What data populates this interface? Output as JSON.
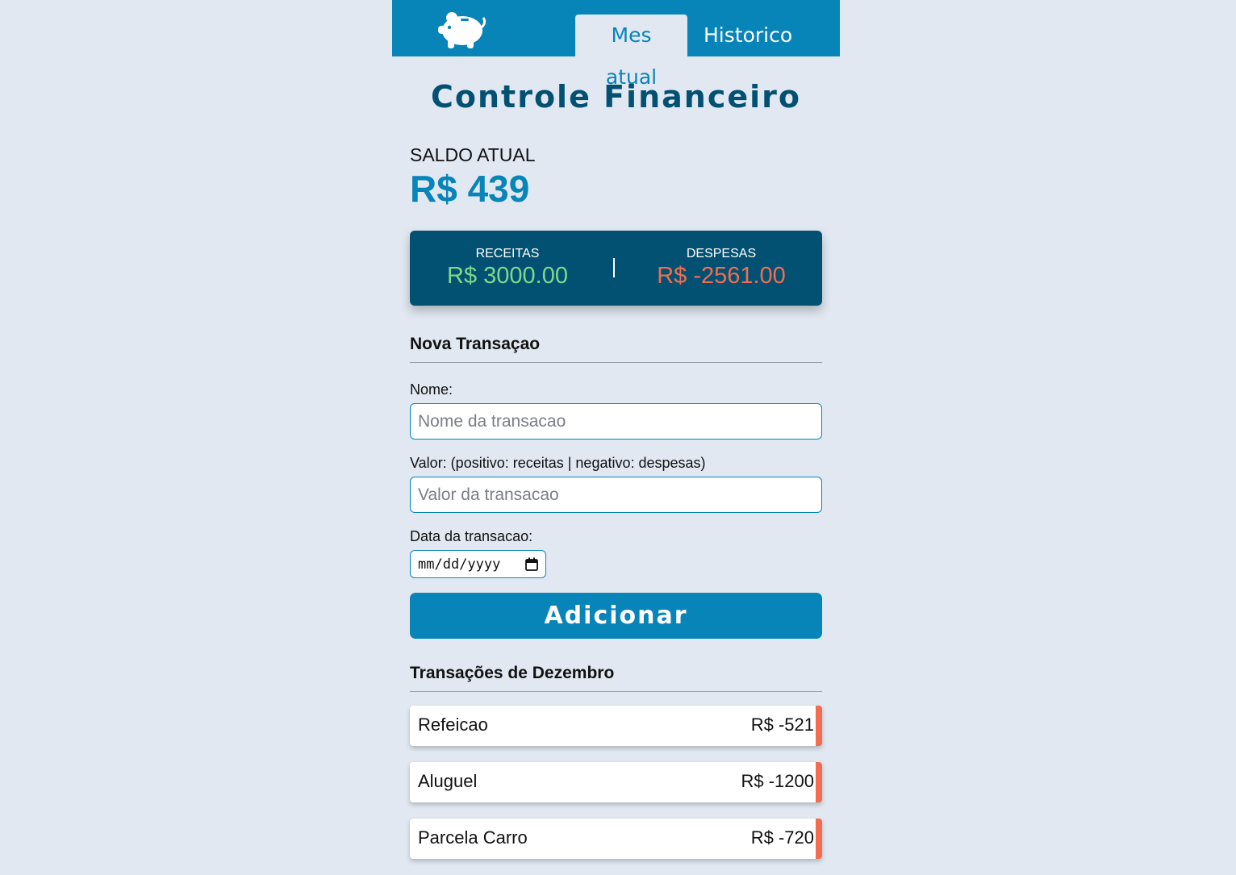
{
  "header": {
    "logo_icon": "piggy-bank-icon",
    "tabs": [
      {
        "label": "Mes atual",
        "active": true
      },
      {
        "label": "Historico",
        "active": false
      }
    ]
  },
  "page": {
    "title": "Controle Financeiro"
  },
  "balance": {
    "label": "SALDO ATUAL",
    "value": "R$ 439"
  },
  "summary": {
    "income_label": "RECEITAS",
    "income_value": "R$ 3000.00",
    "expense_label": "DESPESAS",
    "expense_value": "R$ -2561.00"
  },
  "form": {
    "title": "Nova Transaçao",
    "name_label": "Nome:",
    "name_placeholder": "Nome da transacao",
    "name_value": "",
    "value_label": "Valor: (positivo: receitas | negativo: despesas)",
    "value_placeholder": "Valor da transacao",
    "value_value": "",
    "date_label": "Data da transacao:",
    "date_placeholder": "mm/dd/yyyy",
    "submit_label": "Adicionar"
  },
  "transactions": {
    "title": "Transações de Dezembro",
    "items": [
      {
        "name": "Refeicao",
        "amount": "R$ -521"
      },
      {
        "name": "Aluguel",
        "amount": "R$ -1200"
      },
      {
        "name": "Parcela Carro",
        "amount": "R$ -720"
      }
    ]
  },
  "colors": {
    "primary": "#0784b8",
    "dark": "#035172",
    "background": "#e1e8f2",
    "income": "#7ed98a",
    "expense": "#f26d4f"
  }
}
